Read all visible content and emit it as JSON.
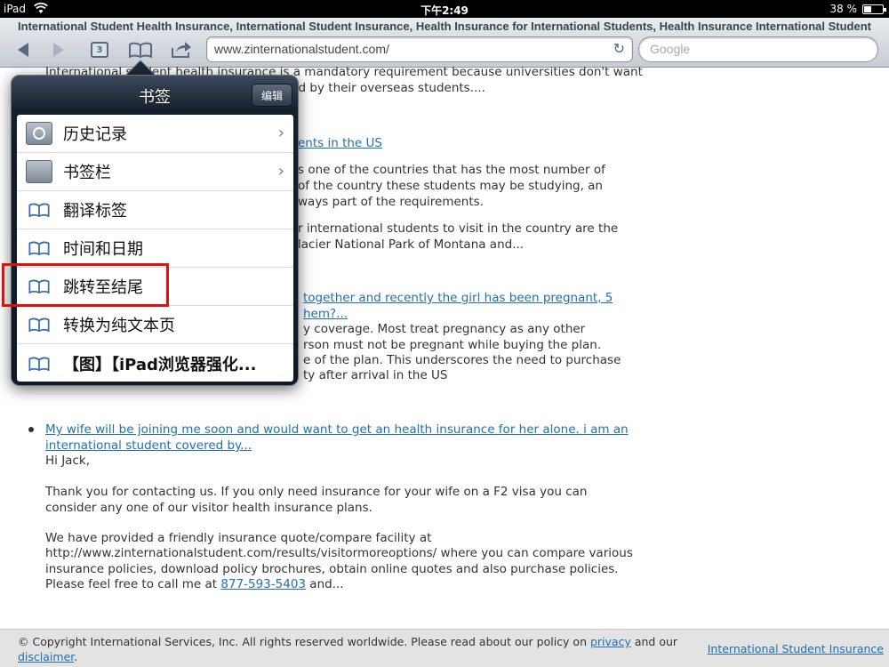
{
  "status_bar": {
    "device": "iPad",
    "time": "下午2:49",
    "battery": "38 %",
    "battery_level": 0.38
  },
  "browser": {
    "page_title": "International Student Health Insurance, International Student Insurance, Health Insurance for International Students, Health Insurance International Student",
    "tab_count": "3",
    "url": "www.zinternationalstudent.com/",
    "search_placeholder": "Google"
  },
  "content": {
    "p1_l1": "International student health insurance is a mandatory requirement because universities don't want",
    "p1_l2": "to bear the burden of medical bills incurred by their overseas students....",
    "link1": "ents in the US",
    "p2_l1": "s one of the countries that has the most number of",
    "p2_l2": "of the country these students may be studying, an",
    "p2_l3": "ways part of the requirements.",
    "p3_l1": "r international students to visit in the country are the",
    "p3_l2": "lacier National Park of Montana and...",
    "link2_l1": "together and recently the girl has been pregnant, 5",
    "link2_l2": "hem?...",
    "p4_l1": "y coverage. Most treat pregnancy as any other",
    "p4_l2": "rson must not be pregnant while buying the plan.",
    "p4_l3": "e of the plan. This underscores the need to purchase",
    "p4_l4": "ty after arrival in the US",
    "link3_l1": "My wife will be joining me soon and would want to get an health insurance for her alone. i am an",
    "link3_l2": "international student covered by...",
    "greeting": "Hi Jack,",
    "p5_l1": "Thank you for contacting us. If you only need insurance for your wife on a F2 visa you can",
    "p5_l2": "consider any one of our visitor health insurance plans.",
    "p6_l1": "We have provided a friendly insurance quote/compare facility at",
    "p6_l2": "http://www.zinternationalstudent.com/results/visitormoreoptions/ where you can compare various",
    "p6_l3": "insurance policies, download policy brochures, obtain online quotes and also purchase policies.",
    "p6_l4_pre": "Please feel free to call me at",
    "phone": "877-593-5403",
    "p6_l4_post": "and..."
  },
  "footer": {
    "copyright": "© Copyright International Services, Inc. All rights reserved worldwide. Please read about our policy on",
    "privacy": "privacy",
    "and": "and our",
    "disclaimer": "disclaimer",
    "period": ".",
    "brand": "International Student Insurance"
  },
  "bookmarks": {
    "title": "书签",
    "edit": "编辑",
    "items": [
      {
        "label": "历史记录",
        "icon": "history-folder-icon"
      },
      {
        "label": "书签栏",
        "icon": "folder-icon"
      },
      {
        "label": "翻译标签",
        "icon": "bookmark-book-icon"
      },
      {
        "label": "时间和日期",
        "icon": "bookmark-book-icon"
      },
      {
        "label": "跳转至结尾",
        "icon": "bookmark-book-icon"
      },
      {
        "label": "转换为纯文本页",
        "icon": "bookmark-book-icon"
      },
      {
        "label": "【图】【iPad浏览器强化...",
        "icon": "bookmark-book-icon"
      }
    ]
  },
  "colors": {
    "link": "#1f6fb2",
    "highlight": "#e01010",
    "popover": "#151e2b"
  }
}
